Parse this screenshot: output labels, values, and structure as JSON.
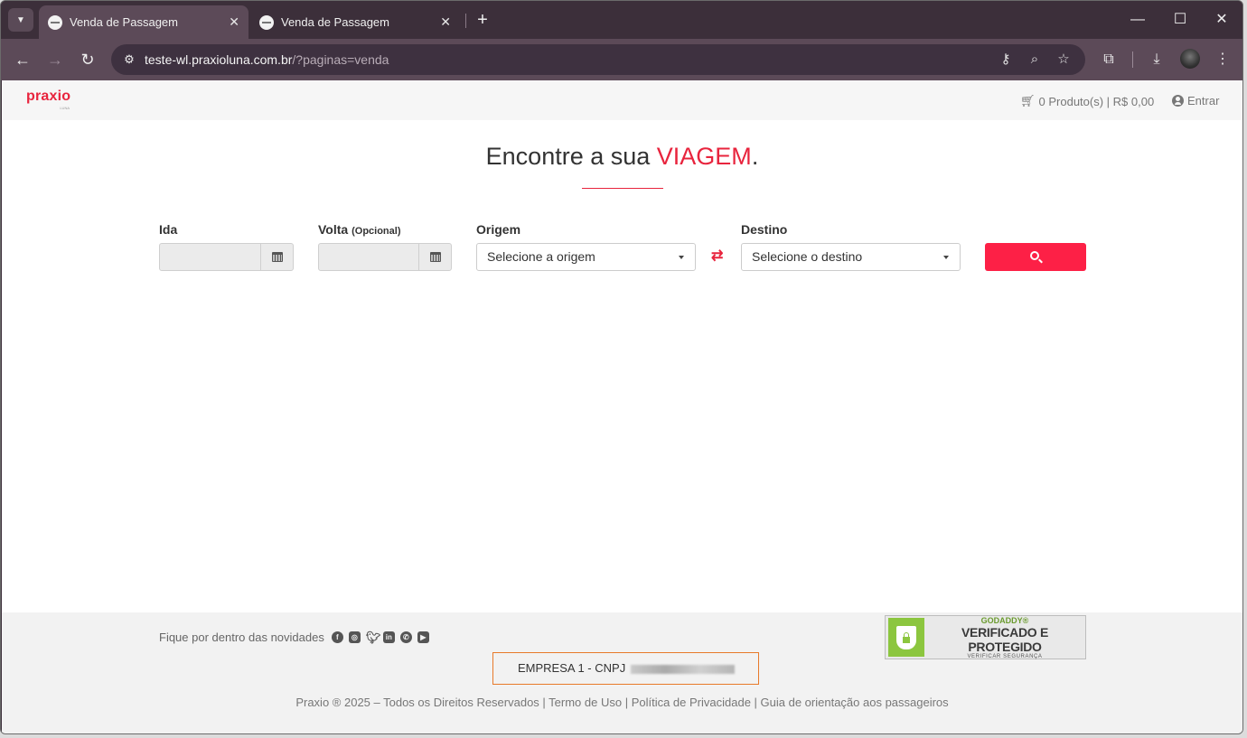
{
  "browser": {
    "tabs": [
      {
        "title": "Venda de Passagem",
        "active": true
      },
      {
        "title": "Venda de Passagem",
        "active": false
      }
    ],
    "url_host": "teste-wl.praxioluna.com.br",
    "url_path": "/?paginas=venda"
  },
  "header": {
    "logo_text": "praxio",
    "logo_sub": "LUNA",
    "cart_text": "0 Produto(s) | R$ 0,00",
    "login_label": "Entrar"
  },
  "hero": {
    "title_prefix": "Encontre a sua ",
    "title_accent": "VIAGEM",
    "title_suffix": "."
  },
  "search": {
    "ida_label": "Ida",
    "ida_value": "",
    "volta_label": "Volta",
    "volta_optional": "(Opcional)",
    "volta_value": "",
    "origem_label": "Origem",
    "origem_value": "Selecione a origem",
    "destino_label": "Destino",
    "destino_value": "Selecione o destino"
  },
  "footer": {
    "newsletter_text": "Fique por dentro das novidades",
    "social_icons": [
      "facebook-icon",
      "instagram-icon",
      "twitter-icon",
      "linkedin-icon",
      "whatsapp-icon",
      "youtube-icon"
    ],
    "godaddy_brand": "GODADDY®",
    "godaddy_main": "VERIFICADO E PROTEGIDO",
    "godaddy_sub": "VERIFICAR SEGURANÇA",
    "company_text": "EMPRESA 1 - CNPJ",
    "copyright": "Praxio ® 2025 – Todos os Direitos Reservados | Termo de Uso | Política de Privacidade | Guia de orientação aos passageiros"
  },
  "colors": {
    "accent": "#e8243d",
    "search_button": "#fd2046",
    "chrome_frame": "#3c2f3a",
    "chrome_toolbar": "#5c4a58"
  }
}
